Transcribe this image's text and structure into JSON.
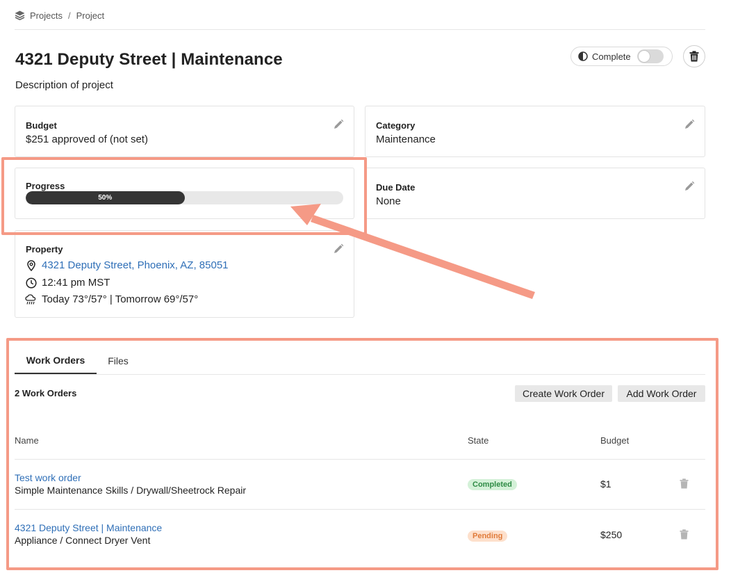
{
  "breadcrumb": {
    "root": "Projects",
    "separator": "/",
    "current": "Project"
  },
  "page": {
    "title": "4321 Deputy Street | Maintenance",
    "description": "Description of project",
    "complete_label": "Complete",
    "complete_on": false
  },
  "cards": {
    "budget": {
      "label": "Budget",
      "value": "$251 approved of (not set)"
    },
    "category": {
      "label": "Category",
      "value": "Maintenance"
    },
    "progress": {
      "label": "Progress",
      "percent": 50,
      "text": "50%"
    },
    "due_date": {
      "label": "Due Date",
      "value": "None"
    },
    "property": {
      "label": "Property",
      "address": "4321 Deputy Street, Phoenix, AZ, 85051",
      "time": "12:41 pm MST",
      "weather": "Today 73°/57° | Tomorrow 69°/57°"
    }
  },
  "tabs": [
    {
      "label": "Work Orders",
      "active": true
    },
    {
      "label": "Files",
      "active": false
    }
  ],
  "work_orders": {
    "count_text": "2 Work Orders",
    "create_button": "Create Work Order",
    "add_button": "Add Work Order",
    "columns": {
      "name": "Name",
      "state": "State",
      "budget": "Budget"
    },
    "rows": [
      {
        "name": "Test work order",
        "subtitle": "Simple Maintenance Skills / Drywall/Sheetrock Repair",
        "state": "Completed",
        "budget": "$1"
      },
      {
        "name": "4321 Deputy Street | Maintenance",
        "subtitle": "Appliance / Connect Dryer Vent",
        "state": "Pending",
        "budget": "$250"
      }
    ]
  },
  "colors": {
    "annotation": "#f59a86",
    "link": "#2f6fb7",
    "progress_fill": "#353535",
    "completed_badge": "#d4f1d8",
    "pending_badge": "#fde0cc"
  }
}
